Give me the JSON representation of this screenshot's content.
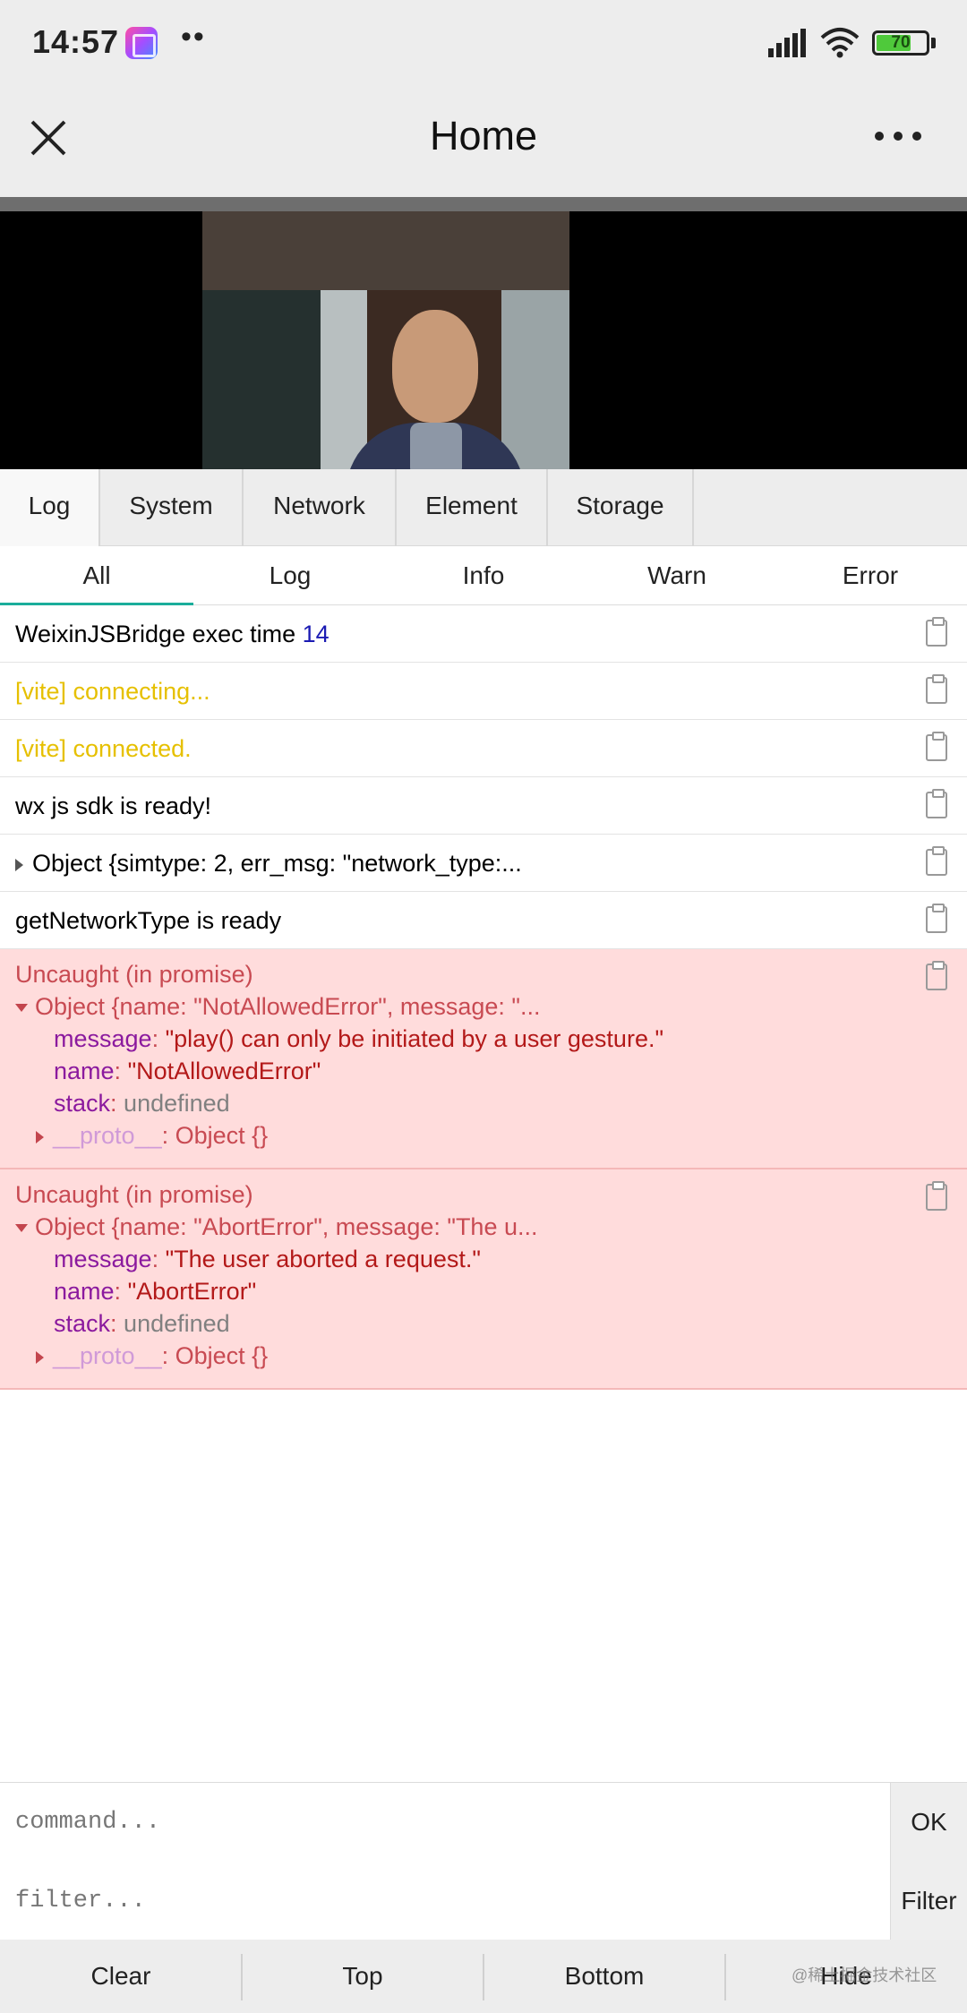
{
  "status_bar": {
    "time": "14:57",
    "dots": "••",
    "battery_level": 70,
    "battery_text": "70",
    "icons": [
      "app-icon",
      "signal-icon",
      "wifi-icon",
      "battery-icon"
    ]
  },
  "nav": {
    "title": "Home",
    "close_icon": "close-icon",
    "more_icon": "more-icon"
  },
  "panel_tabs": [
    "Log",
    "System",
    "Network",
    "Element",
    "Storage"
  ],
  "active_panel_tab": "Log",
  "filter_tabs": [
    "All",
    "Log",
    "Info",
    "Warn",
    "Error"
  ],
  "active_filter_tab": "All",
  "logs": [
    {
      "text": "WeixinJSBridge exec time ",
      "value": "14"
    },
    {
      "text": "[vite] connecting...",
      "level": "warn"
    },
    {
      "text": "[vite] connected.",
      "level": "warn"
    },
    {
      "text": "wx js sdk is ready!"
    },
    {
      "text": "Object {simtype: 2, err_msg: \"network_type:..."
    },
    {
      "text": "getNetworkType is ready"
    }
  ],
  "errors": [
    {
      "title": "Uncaught (in promise)",
      "summary": "Object {name: \"NotAllowedError\", message: \"...",
      "message_key": "message",
      "message_val": "\"play() can only be initiated by a user gesture.\"",
      "name_key": "name",
      "name_val": "\"NotAllowedError\"",
      "stack_key": "stack",
      "stack_val": "undefined",
      "proto_key": "__proto__",
      "proto_val": "Object {}"
    },
    {
      "title": "Uncaught (in promise)",
      "summary": "Object {name: \"AbortError\", message: \"The u...",
      "message_key": "message",
      "message_val": "\"The user aborted a request.\"",
      "name_key": "name",
      "name_val": "\"AbortError\"",
      "stack_key": "stack",
      "stack_val": "undefined",
      "proto_key": "__proto__",
      "proto_val": "Object {}"
    }
  ],
  "command": {
    "placeholder": "command...",
    "button": "OK"
  },
  "filter": {
    "placeholder": "filter...",
    "button": "Filter"
  },
  "toolbar": [
    "Clear",
    "Top",
    "Bottom",
    "Hide"
  ],
  "watermark": "@稀土掘金技术社区",
  "colors": {
    "accent": "#1aad9b",
    "warn": "#e6c000",
    "error_bg": "#ffdcdc",
    "error_text": "#c84a52"
  }
}
